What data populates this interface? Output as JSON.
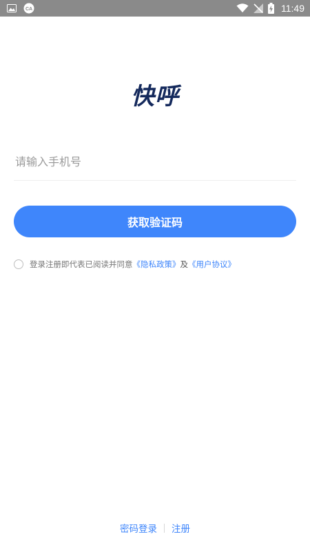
{
  "status_bar": {
    "time": "11:49",
    "left_icons": [
      "image-icon",
      "cast-icon"
    ],
    "right_icons": [
      "wifi-icon",
      "no-signal-icon",
      "battery-charging-icon"
    ]
  },
  "app": {
    "logo_text": "快呼"
  },
  "login_form": {
    "phone_placeholder": "请输入手机号",
    "phone_value": "",
    "get_code_button": "获取验证码"
  },
  "agreement": {
    "prefix": "登录注册即代表已阅读并同意",
    "privacy_link": "《隐私政策》",
    "conjunction": "及",
    "terms_link": "《用户协议》",
    "checked": false
  },
  "footer": {
    "password_login": "密码登录",
    "register": "注册"
  },
  "colors": {
    "primary": "#3f86fb",
    "logo": "#14295c",
    "status_bar": "#8a8a8a"
  }
}
